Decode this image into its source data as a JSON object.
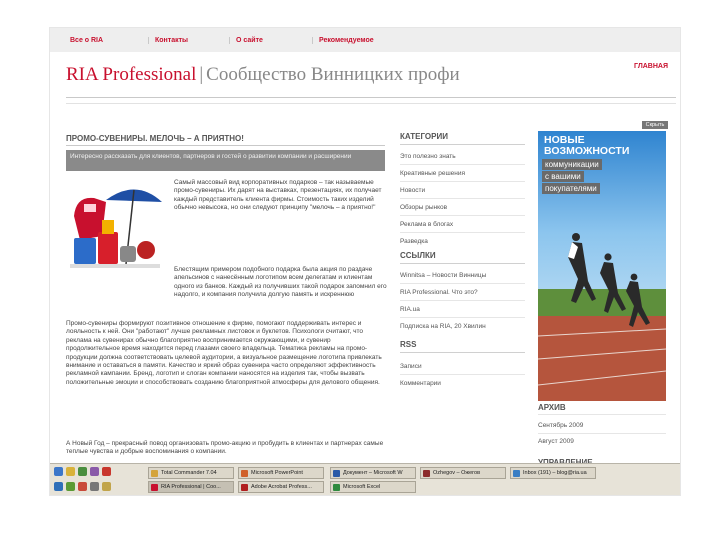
{
  "nav": [
    "Все о RIA",
    "Контакты",
    "О сайте",
    "Рекомендуемое"
  ],
  "header": {
    "brand": "RIA Professional",
    "separator": "|",
    "subtitle": "Сообщество Винницких профи",
    "right_link": "ГЛАВНАЯ"
  },
  "post": {
    "title": "ПРОМО-СУВЕНИРЫ. МЕЛОЧЬ – А ПРИЯТНО!",
    "lead": "Интересно рассказать для клиентов, партнеров и гостей о развитии компании и расширении",
    "para1": "Самый массовый вид корпоративных подарков – так называемые промо-сувениры. Их дарят на выставках, презентациях, их получает каждый представитель клиента фирмы. Стоимость таких изделий обычно невысока, но они следуют принципу \"мелочь – а приятно!\"",
    "para2": "Блестящим примером подобного подарка была акция по раздаче апельсинов с нанесённым логотипом всем делегатам и клиентам одного из банков. Каждый из получивших такой подарок запомнил его надолго, и компания получила долгую память и искреннюю благодарность своих клиентов и партнеров.",
    "para3": "Промо-сувениры формируют позитивное отношение к фирме, помогают поддерживать интерес и лояльность к ней. Они \"работают\" лучше рекламных листовок и буклетов. Психологи считают, что реклама на сувенирах обычно благоприятно воспринимается окружающими, и сувенир продолжительное время находится перед глазами своего владельца. Тематика рекламы на промо-продукции должна соответствовать целевой аудитории, а визуальное размещение логотипа привлекать внимание и оставаться в памяти. Качество и яркий образ сувенира часто определяют эффективность рекламной кампании. Бренд, логотип и слоган компании наносятся на изделия так, чтобы вызвать положительные эмоции и способствовать созданию благоприятной атмосферы для делового общения.",
    "para4": "А Новый Год – прекрасный повод организовать промо-акцию и пробудить в клиентах и партнерах самые теплые чувства и добрые воспоминания о компании."
  },
  "sidebar": {
    "categories_title": "КАТЕГОРИИ",
    "categories": [
      "Это полезно знать",
      "Креативные решения",
      "Новости",
      "Обзоры рынков",
      "Реклама в блогах",
      "Разведка"
    ],
    "links_title": "ССЫЛКИ",
    "links": [
      "Winnitsa – Новости Винницы",
      "RIA Professional. Что это?",
      "RIA.ua",
      "Подписка на RIA, 20 Хвилин"
    ],
    "rss_title": "RSS",
    "rss": [
      "Записи",
      "Комментарии"
    ]
  },
  "ad": {
    "hide_label": "Скрыть",
    "headline": "НОВЫЕ ВОЗМОЖНОСТИ",
    "line1": "коммуникации",
    "line2": "с вашими",
    "line3": "покупателями"
  },
  "archive": {
    "title": "АРХИВ",
    "items": [
      "Сентябрь 2009",
      "Август 2009"
    ]
  },
  "manage_title": "УПРАВЛЕНИЕ",
  "taskbar": {
    "row1": [
      "Total Commander 7.04",
      "Microsoft PowerPoint",
      "Документ – Microsoft W",
      "Ozhegov – Ожегов",
      "Inbox (191) – blog@ria.ua"
    ],
    "row2": [
      "RIA Professional | Соо...",
      "Adobe Acrobat Profess...",
      "Microsoft Excel"
    ]
  },
  "colors": {
    "brand": "#c8102e",
    "ad_blue": "#3f8fd0",
    "taskbar": "#e7e3d8"
  }
}
